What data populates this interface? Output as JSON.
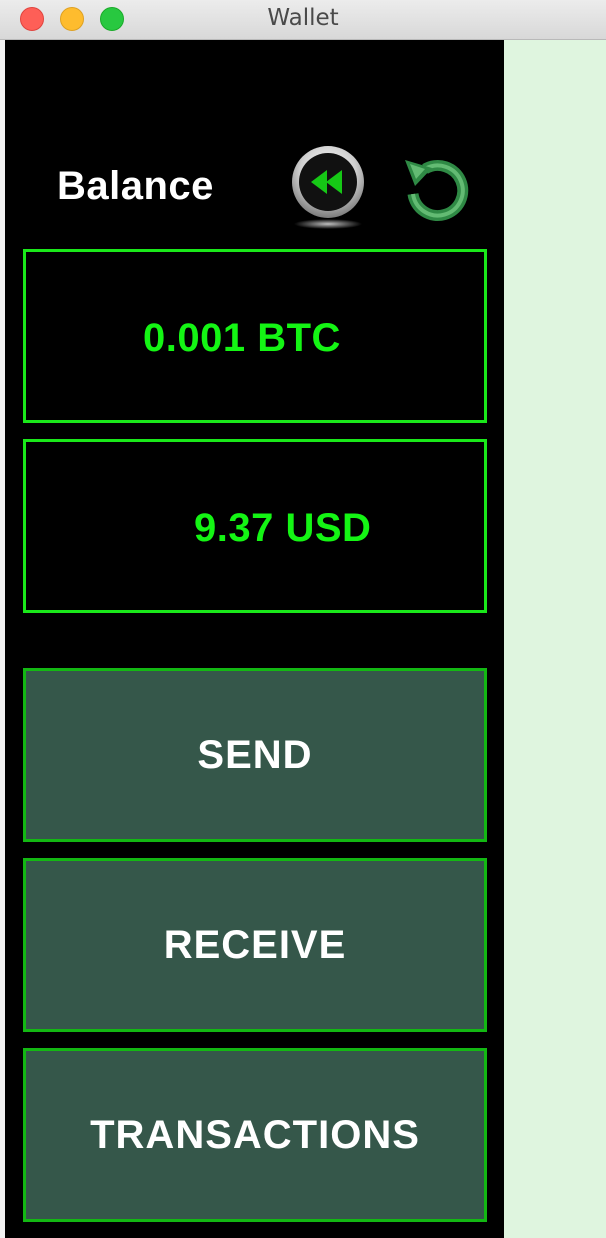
{
  "window": {
    "title": "Wallet"
  },
  "balance": {
    "label": "Balance",
    "btc": "0.001 BTC",
    "usd": "9.37 USD"
  },
  "toolbar": {
    "back_icon": "rewind-icon",
    "refresh_icon": "refresh-icon"
  },
  "actions": {
    "send": "SEND",
    "receive": "RECEIVE",
    "transactions": "TRANSACTIONS"
  },
  "colors": {
    "panel_background": "#000000",
    "amount_text": "#14f514",
    "amount_border": "#1ae81a",
    "button_background": "#35574a",
    "button_border": "#13b813",
    "window_background": "#dff5df"
  }
}
